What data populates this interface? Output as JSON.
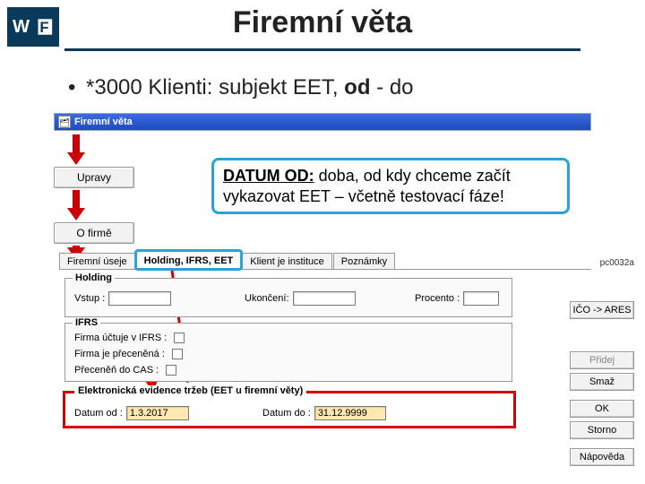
{
  "title": "Firemní věta",
  "bullet": {
    "text_before": "*3000 Klienti: subjekt EET, ",
    "od": "od",
    "text_after": " - do"
  },
  "window": {
    "title": "Firemní věta"
  },
  "left_buttons": {
    "upravy": "Upravy",
    "ofirme": "O firmě"
  },
  "callout": {
    "label": "DATUM OD:",
    "rest1": " doba, od kdy chceme začít vykazovat EET – včetně testovací fáze!"
  },
  "tabs": {
    "t0": "Firemní úseje",
    "t1": "Holding, IFRS, EET",
    "t2": "Klient je instituce",
    "t3": "Poznámky"
  },
  "holding": {
    "legend": "Holding",
    "vstup": "Vstup :",
    "ukonceni": "Ukončení:",
    "procento": "Procento :"
  },
  "ifrs": {
    "legend": "IFRS",
    "r1": "Firma účtuje v IFRS :",
    "r2": "Firma je přeceněná :",
    "r3": "Přeceněň do CAS :"
  },
  "eet": {
    "legend": "Elektronická evidence tržeb (EET u firemní věty)",
    "od_lbl": "Datum od :",
    "od_val": "1.3.2017",
    "do_lbl": "Datum do :",
    "do_val": "31.12.9999"
  },
  "right": {
    "pc": "pc0032a",
    "ico": "IČO -> ARES",
    "pridej": "Přidej",
    "smaz": "Smaž",
    "ok": "OK",
    "storno": "Storno",
    "napoveda": "Nápověda"
  }
}
